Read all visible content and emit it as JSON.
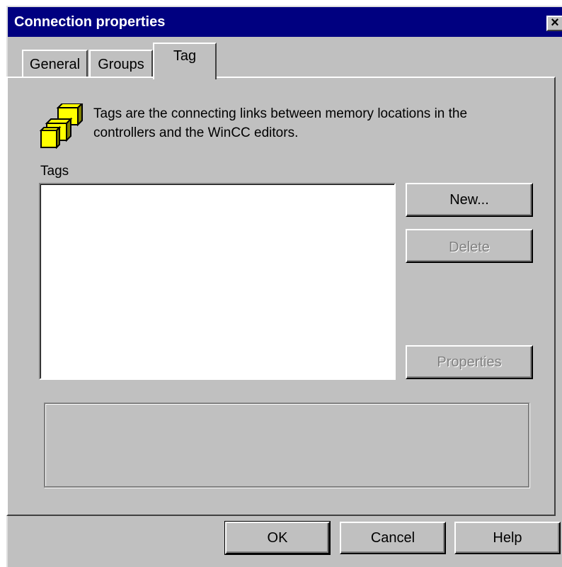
{
  "window": {
    "title": "Connection properties",
    "close_label": "×"
  },
  "tabs": [
    {
      "label": "General",
      "active": false
    },
    {
      "label": "Groups",
      "active": false
    },
    {
      "label": "Tag",
      "active": true
    }
  ],
  "panel": {
    "info_text": "Tags are the connecting links between memory locations in the controllers and the WinCC editors.",
    "tags_label": "Tags",
    "tags_list": [],
    "buttons": {
      "new_label": "New...",
      "delete_label": "Delete",
      "properties_label": "Properties"
    },
    "icon": "yellow-cubes-icon"
  },
  "footer": {
    "ok_label": "OK",
    "cancel_label": "Cancel",
    "help_label": "Help"
  },
  "colors": {
    "titlebar": "#000080",
    "dialog_bg": "#c0c0c0",
    "icon_yellow": "#ffff00"
  }
}
